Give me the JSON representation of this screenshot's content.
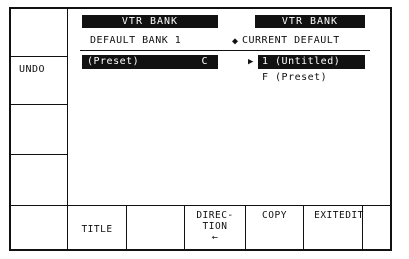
{
  "header": {
    "left_title": "VTR BANK",
    "right_title": "VTR BANK",
    "left_sub": "DEFAULT BANK 1",
    "right_sub": "CURRENT DEFAULT"
  },
  "left_panel": {
    "label": "UNDO"
  },
  "left_bank": {
    "name": "(Preset)",
    "code": "C"
  },
  "right_bank": {
    "items": [
      {
        "label": "1 (Untitled)"
      },
      {
        "label": "F (Preset)"
      }
    ]
  },
  "softkeys": {
    "title": "TITLE",
    "direction_line1": "DIREC-",
    "direction_line2": "TION",
    "direction_arrow": "←",
    "copy": "COPY",
    "exitedit": "EXITEDIT"
  },
  "icons": {
    "selection_marker": "right-triangle",
    "direction_arrow": "left-arrow",
    "center_arrow": "left-arrow"
  }
}
